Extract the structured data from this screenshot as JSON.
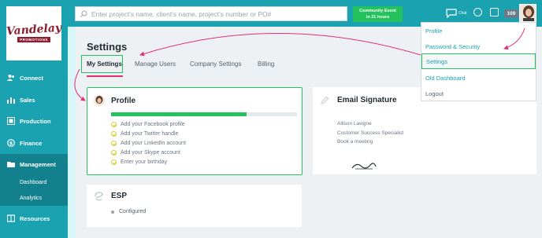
{
  "brand": {
    "logo_main": "Vandelay",
    "logo_sub": "PROMOTIONS"
  },
  "colors": {
    "accent": "#1aa2b0",
    "accent_dark": "#13818d",
    "success": "#23c25d",
    "highlight": "#e0307a"
  },
  "sidebar": {
    "items": [
      {
        "label": "Connect",
        "icon": "people-icon"
      },
      {
        "label": "Sales",
        "icon": "bar-chart-icon"
      },
      {
        "label": "Production",
        "icon": "production-icon"
      },
      {
        "label": "Finance",
        "icon": "dollar-icon"
      },
      {
        "label": "Management",
        "icon": "management-icon"
      },
      {
        "label": "Resources",
        "icon": "book-icon"
      }
    ],
    "sub_items": [
      "Dashboard",
      "Analytics"
    ]
  },
  "topbar": {
    "search_placeholder": "Enter project's name, client's name, project's number or PO#",
    "community_line1": "Community Event",
    "community_line2": "in 21 hours",
    "chat_label": "Chat",
    "badge_count": "109"
  },
  "main": {
    "title": "Settings",
    "tabs": [
      "My Settings",
      "Manage Users",
      "Company Settings",
      "Billing"
    ]
  },
  "profile": {
    "title": "Profile",
    "progress": 0.73,
    "todos": [
      "Add your Facebook profile",
      "Add your Twitter handle",
      "Add your LinkedIn account",
      "Add your Skype account",
      "Enter your birthday"
    ]
  },
  "email_signature": {
    "title": "Email Signature",
    "lines": [
      "Allison Lavigne",
      "Customer Success Specialist",
      "Book a meeting"
    ]
  },
  "esp": {
    "title": "ESP",
    "status": "Configured"
  },
  "dropdown": {
    "items": [
      "Profile",
      "Password & Security",
      "Settings",
      "Old Dashboard",
      "Logout"
    ]
  }
}
